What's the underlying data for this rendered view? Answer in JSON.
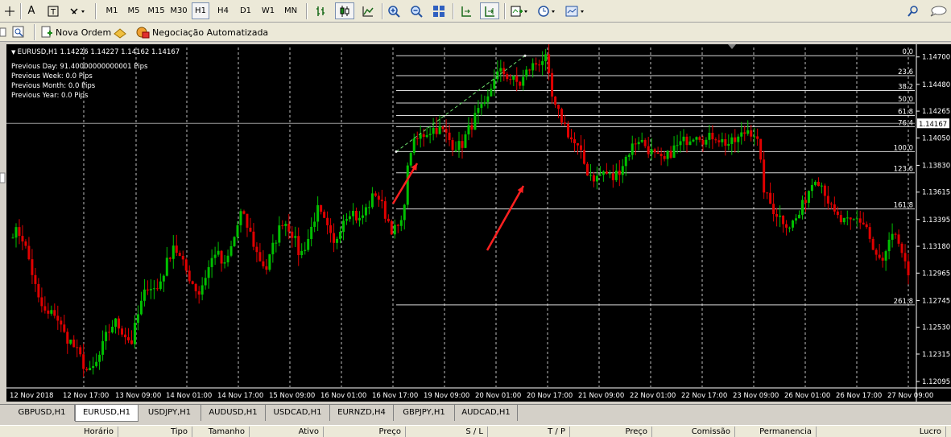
{
  "toolbar": {
    "periods": [
      "M1",
      "M5",
      "M15",
      "M30",
      "H1",
      "H4",
      "D1",
      "W1",
      "MN"
    ],
    "active_period": "H1",
    "text_tool": "A",
    "new_order": "Nova Ordem",
    "auto_trading": "Negociação Automatizada"
  },
  "chart": {
    "symbol_line": "EURUSD,H1  1.14226 1.14227 1.14162 1.14167",
    "info_lines": [
      "Previous Day: 91.40000000000001 Pips",
      "Previous Week: 0.0 Pips",
      "Previous Month: 0.0 Pips",
      "Previous Year: 0.0 Pips"
    ],
    "current_price": "1.14167",
    "colors": {
      "bull": "#00c000",
      "bear": "#e00000",
      "background": "#000000",
      "grid": "#ffffff",
      "arrow": "#ff2020"
    }
  },
  "chart_data": {
    "type": "candlestick",
    "symbol": "EURUSD",
    "timeframe": "H1",
    "ylim": [
      1.1205,
      1.1475
    ],
    "y_ticks": [
      "1.14700",
      "1.14480",
      "1.14265",
      "1.14050",
      "1.13830",
      "1.13615",
      "1.13395",
      "1.13180",
      "1.12965",
      "1.12745",
      "1.12530",
      "1.12315",
      "1.12095"
    ],
    "x_labels": [
      "12 Nov 2018",
      "12 Nov 17:00",
      "13 Nov 09:00",
      "14 Nov 01:00",
      "14 Nov 17:00",
      "15 Nov 09:00",
      "16 Nov 01:00",
      "16 Nov 17:00",
      "19 Nov 09:00",
      "20 Nov 01:00",
      "20 Nov 17:00",
      "21 Nov 09:00",
      "22 Nov 01:00",
      "22 Nov 17:00",
      "23 Nov 09:00",
      "26 Nov 01:00",
      "26 Nov 17:00",
      "27 Nov 09:00"
    ],
    "fibonacci": {
      "levels": [
        "0.0",
        "23.6",
        "38.2",
        "50.0",
        "61.8",
        "76.4",
        "100.0",
        "123.6",
        "161.8",
        "261.8"
      ],
      "prices": [
        1.1471,
        1.1455,
        1.1443,
        1.1433,
        1.1423,
        1.1414,
        1.1394,
        1.1377,
        1.1348,
        1.1271
      ]
    },
    "path_points": [
      1.133,
      1.1328,
      1.1305,
      1.1275,
      1.1262,
      1.1265,
      1.1248,
      1.124,
      1.1228,
      1.1215,
      1.1225,
      1.1245,
      1.1258,
      1.125,
      1.124,
      1.1268,
      1.1288,
      1.1282,
      1.13,
      1.132,
      1.1305,
      1.1292,
      1.128,
      1.1298,
      1.1315,
      1.13,
      1.132,
      1.1345,
      1.133,
      1.131,
      1.13,
      1.1322,
      1.134,
      1.133,
      1.131,
      1.1325,
      1.1348,
      1.1335,
      1.1318,
      1.134,
      1.1348,
      1.1338,
      1.135,
      1.1362,
      1.1345,
      1.133,
      1.1335,
      1.1395,
      1.1405,
      1.141,
      1.1413,
      1.141,
      1.14,
      1.1398,
      1.1412,
      1.1425,
      1.143,
      1.1455,
      1.1458,
      1.1452,
      1.1448,
      1.146,
      1.1465,
      1.147,
      1.143,
      1.142,
      1.1405,
      1.1395,
      1.1378,
      1.1372,
      1.1378,
      1.1372,
      1.1382,
      1.1395,
      1.1405,
      1.1398,
      1.139,
      1.1385,
      1.1395,
      1.14,
      1.1405,
      1.141,
      1.1402,
      1.1408,
      1.1402,
      1.14,
      1.1405,
      1.1412,
      1.1408,
      1.136,
      1.1348,
      1.134,
      1.1335,
      1.1342,
      1.136,
      1.1375,
      1.1365,
      1.1345,
      1.1338,
      1.1336,
      1.134,
      1.1335,
      1.131,
      1.1305,
      1.1325,
      1.132,
      1.129
    ]
  },
  "tabs": [
    "GBPUSD,H1",
    "EURUSD,H1",
    "USDJPY,H1",
    "AUDUSD,H1",
    "USDCAD,H1",
    "EURNZD,H4",
    "GBPJPY,H1",
    "AUDCAD,H1"
  ],
  "active_tab": "EURUSD,H1",
  "columns": [
    "Horário",
    "Tipo",
    "Tamanho",
    "Ativo",
    "Preço",
    "S / L",
    "T / P",
    "Preço",
    "Comissão",
    "Permanencia",
    "Lucro"
  ]
}
